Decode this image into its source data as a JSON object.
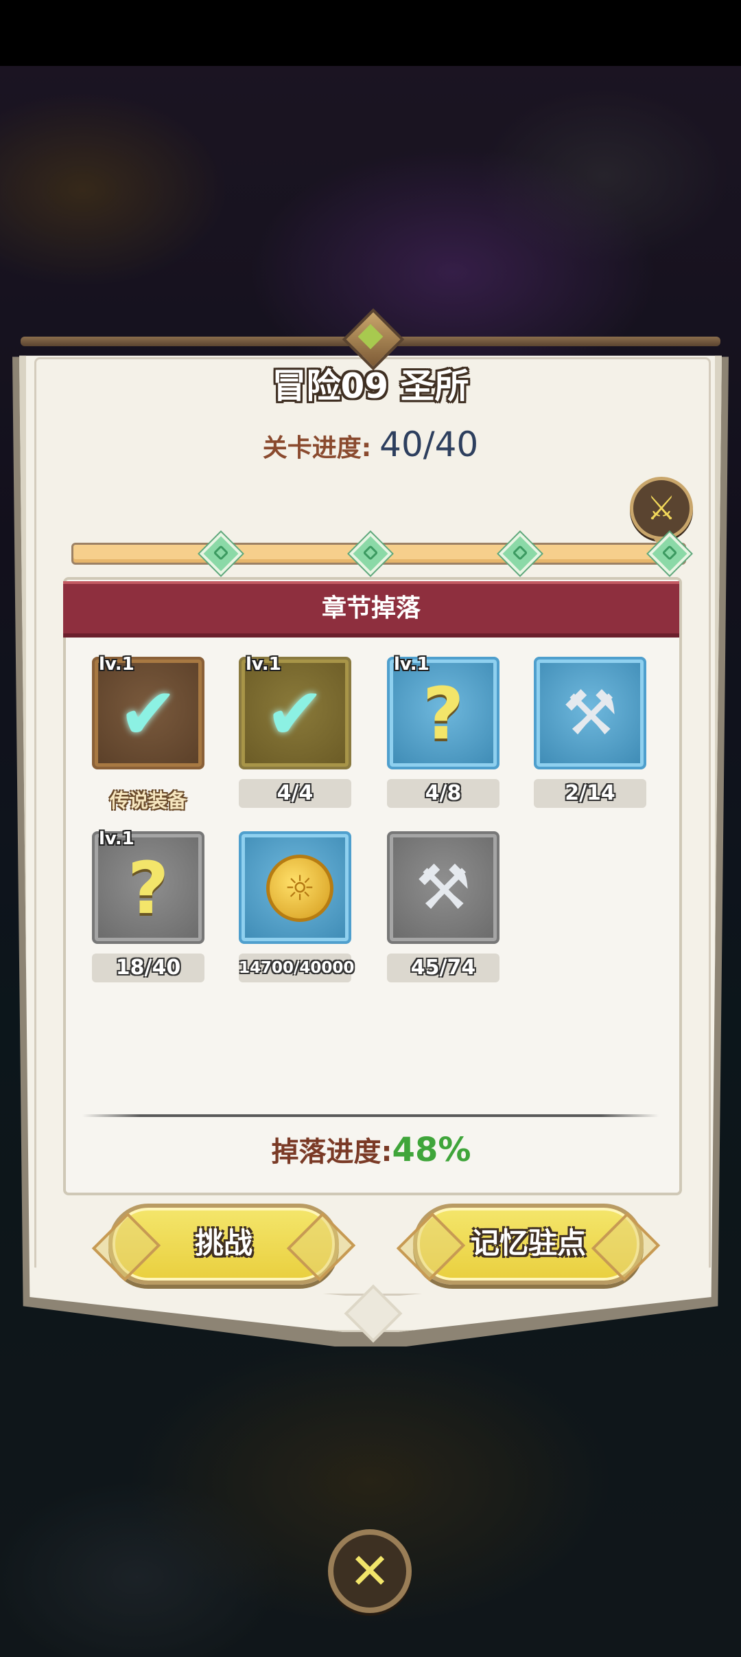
{
  "dialog": {
    "title": "冒险09 圣所",
    "stage_progress_label": "关卡进度:",
    "stage_progress_value": "40/40",
    "milestones_reached": 4,
    "milestones_total": 4,
    "drop_section_title": "章节掉落",
    "drop_progress_label": "掉落进度:",
    "drop_progress_value": "48%",
    "drop_progress_fraction": 0.48,
    "colors": {
      "header": "#8e2f3e",
      "progress_value": "#3fa53a",
      "button": "#f4e66c"
    }
  },
  "drops": [
    {
      "icon": "armor-check-icon",
      "frame": "brown",
      "level": "lv.1",
      "caption": "传说装备"
    },
    {
      "icon": "armor-check-icon",
      "frame": "olive",
      "level": "lv.1",
      "count": "4/4"
    },
    {
      "icon": "mystery-armor-icon",
      "frame": "blue",
      "level": "lv.1",
      "count": "4/8"
    },
    {
      "icon": "hammer-icon",
      "frame": "blue",
      "count": "2/14"
    },
    {
      "icon": "mystery-armor-icon",
      "frame": "gray",
      "level": "lv.1",
      "count": "18/40"
    },
    {
      "icon": "gold-coin-icon",
      "frame": "blue",
      "count": "14700/40000"
    },
    {
      "icon": "hammer-icon",
      "frame": "gray",
      "count": "45/74"
    }
  ],
  "buttons": {
    "challenge": "挑战",
    "memory_checkpoint": "记忆驻点"
  }
}
